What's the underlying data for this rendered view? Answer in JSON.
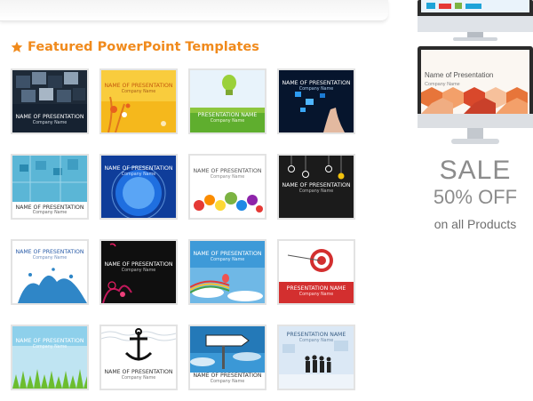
{
  "section": {
    "title": "Featured PowerPoint Templates",
    "icon": "star-icon",
    "accent": "#f08a1c"
  },
  "templates": [
    {
      "name": "NAME OF PRESENTATION",
      "company": "Company Name",
      "theme": "dark-cubes"
    },
    {
      "name": "NAME OF PRESENTATION",
      "company": "Company Name",
      "theme": "yellow-floral"
    },
    {
      "name": "PRESENTATION NAME",
      "company": "Company Name",
      "theme": "green-bulb"
    },
    {
      "name": "NAME OF PRESENTATION",
      "company": "Company Name",
      "theme": "touch-screen"
    },
    {
      "name": "NAME OF PRESENTATION",
      "company": "Company Name",
      "theme": "circuit"
    },
    {
      "name": "NAME OF PRESENTATION",
      "company": "Company Name",
      "theme": "globe"
    },
    {
      "name": "NAME OF PRESENTATION",
      "company": "Company Name",
      "theme": "gears"
    },
    {
      "name": "NAME OF PRESENTATION",
      "company": "Company Name",
      "theme": "light-bulbs"
    },
    {
      "name": "NAME OF PRESENTATION",
      "company": "Company Name",
      "theme": "water-splash"
    },
    {
      "name": "NAME OF PRESENTATION",
      "company": "Company Name",
      "theme": "black-floral"
    },
    {
      "name": "NAME OF PRESENTATION",
      "company": "Company Name",
      "theme": "sky-balloon"
    },
    {
      "name": "PRESENTATION NAME",
      "company": "Company Name",
      "theme": "target"
    },
    {
      "name": "NAME OF PRESENTATION",
      "company": "Company Name",
      "theme": "grass"
    },
    {
      "name": "NAME OF PRESENTATION",
      "company": "Company Name",
      "theme": "anchor"
    },
    {
      "name": "NAME OF PRESENTATION",
      "company": "Company Name",
      "theme": "right-way"
    },
    {
      "name": "PRESENTATION NAME",
      "company": "Company Name",
      "theme": "business-team"
    }
  ],
  "sidebar": {
    "monitor2": {
      "name": "Name of Presentation",
      "company": "Company Name"
    },
    "sale": {
      "line1": "SALE",
      "line2": "50% OFF",
      "line3": "on all Products"
    }
  }
}
